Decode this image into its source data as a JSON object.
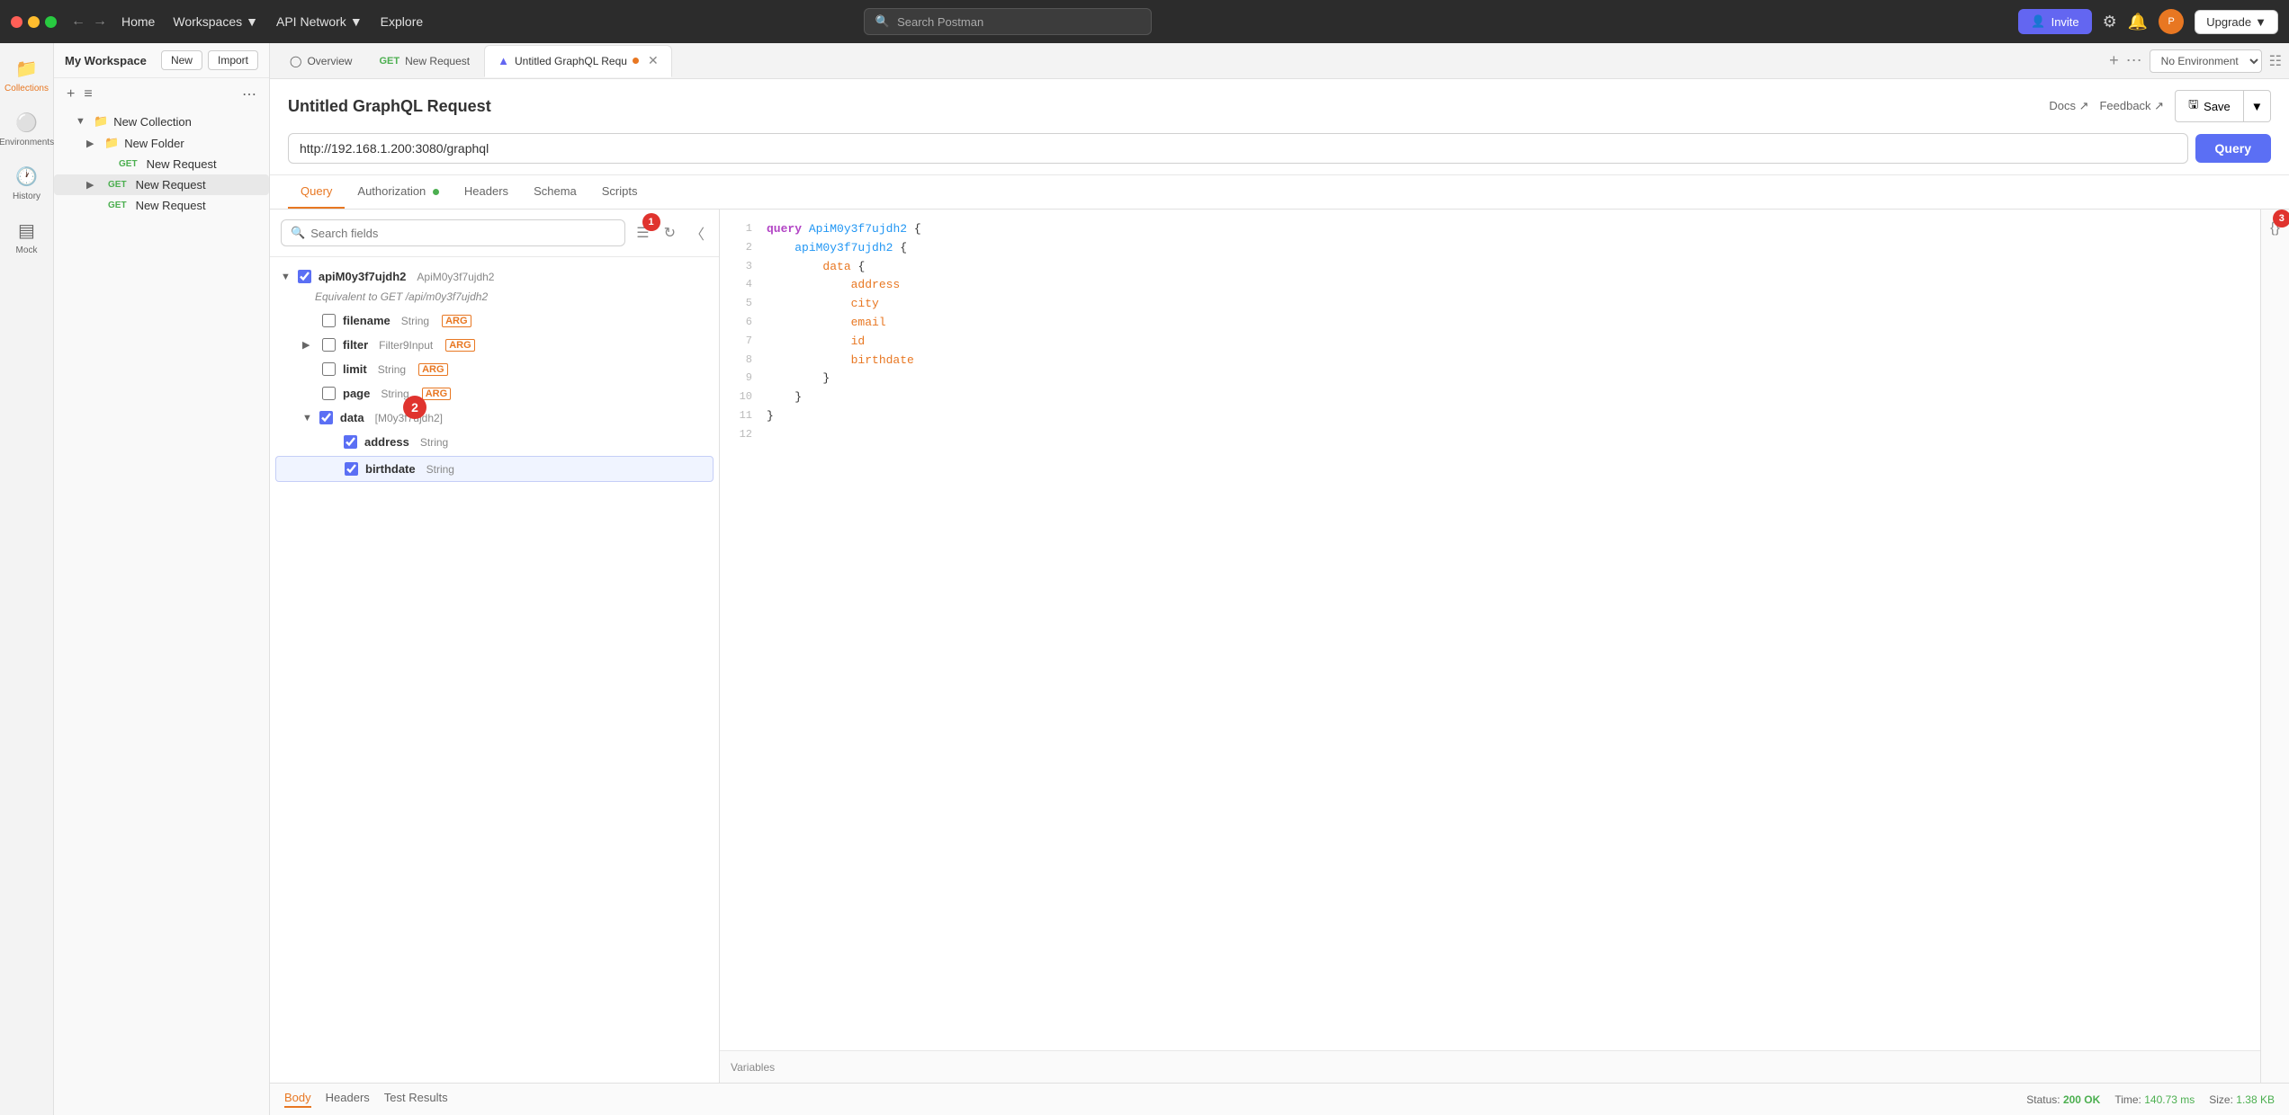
{
  "topbar": {
    "nav_items": [
      "Home",
      "Workspaces",
      "API Network",
      "Explore"
    ],
    "search_placeholder": "Search Postman",
    "invite_label": "Invite",
    "upgrade_label": "Upgrade"
  },
  "sidebar": {
    "workspace_name": "My Workspace",
    "new_label": "New",
    "import_label": "Import",
    "collections_label": "Collections",
    "environments_label": "Environments",
    "history_label": "History",
    "mock_label": "Mock",
    "collection_name": "New Collection",
    "folder_name": "New Folder",
    "requests": [
      {
        "method": "GET",
        "name": "New Request",
        "indent": 2
      },
      {
        "method": "GET",
        "name": "New Request",
        "indent": 3
      },
      {
        "method": "GET",
        "name": "New Request",
        "indent": 2
      }
    ]
  },
  "tabs": [
    {
      "label": "Overview",
      "type": "overview",
      "active": false
    },
    {
      "label": "New Request",
      "type": "get",
      "active": false
    },
    {
      "label": "Untitled GraphQL Requ",
      "type": "graphql",
      "active": true,
      "dot": true
    }
  ],
  "env_select": "No Environment",
  "request": {
    "title": "Untitled GraphQL Request",
    "docs_label": "Docs ↗",
    "feedback_label": "Feedback ↗",
    "save_label": "Save",
    "url": "http://192.168.1.200:3080/graphql",
    "query_button": "Query"
  },
  "query_tabs": [
    {
      "label": "Query",
      "active": true
    },
    {
      "label": "Authorization",
      "dot": true,
      "active": false
    },
    {
      "label": "Headers",
      "active": false
    },
    {
      "label": "Schema",
      "active": false
    },
    {
      "label": "Scripts",
      "active": false
    }
  ],
  "fields_panel": {
    "search_placeholder": "Search fields",
    "group": {
      "name": "apiM0y3f7ujdh2",
      "type": "ApiM0y3f7ujdh2",
      "desc": "Equivalent to GET /api/m0y3f7ujdh2",
      "checked": true,
      "fields": [
        {
          "name": "filename",
          "type": "String",
          "arg": "ARG",
          "checked": false,
          "expandable": false
        },
        {
          "name": "filter",
          "type": "Filter9Input",
          "arg": "ARG",
          "checked": false,
          "expandable": true
        },
        {
          "name": "limit",
          "type": "String",
          "arg": "ARG",
          "checked": false,
          "expandable": false
        },
        {
          "name": "page",
          "type": "String",
          "arg": "ARG",
          "checked": false,
          "expandable": false
        },
        {
          "name": "data",
          "type": "[M0y3f7ujdh2]",
          "checked": true,
          "expandable": true,
          "subfields": [
            {
              "name": "address",
              "type": "String",
              "checked": true
            },
            {
              "name": "birthdate",
              "type": "String",
              "checked": true,
              "highlighted": true
            }
          ]
        }
      ]
    }
  },
  "code_editor": {
    "lines": [
      {
        "num": 1,
        "code": "query ApiM0y3f7ujdh2 {",
        "parts": [
          {
            "t": "kw",
            "v": "query"
          },
          {
            "t": "text",
            "v": " "
          },
          {
            "t": "fn",
            "v": "ApiM0y3f7ujdh2"
          },
          {
            "t": "text",
            "v": " {"
          }
        ]
      },
      {
        "num": 2,
        "code": "    apiM0y3f7ujdh2 {",
        "parts": [
          {
            "t": "text",
            "v": "    "
          },
          {
            "t": "fn",
            "v": "apiM0y3f7ujdh2"
          },
          {
            "t": "text",
            "v": " {"
          }
        ]
      },
      {
        "num": 3,
        "code": "        data {",
        "parts": [
          {
            "t": "text",
            "v": "        "
          },
          {
            "t": "field",
            "v": "data"
          },
          {
            "t": "text",
            "v": " {"
          }
        ]
      },
      {
        "num": 4,
        "code": "            address",
        "parts": [
          {
            "t": "text",
            "v": "            "
          },
          {
            "t": "field",
            "v": "address"
          }
        ]
      },
      {
        "num": 5,
        "code": "            city",
        "parts": [
          {
            "t": "text",
            "v": "            "
          },
          {
            "t": "field",
            "v": "city"
          }
        ]
      },
      {
        "num": 6,
        "code": "            email",
        "parts": [
          {
            "t": "text",
            "v": "            "
          },
          {
            "t": "field",
            "v": "email"
          }
        ]
      },
      {
        "num": 7,
        "code": "            id",
        "parts": [
          {
            "t": "text",
            "v": "            "
          },
          {
            "t": "field",
            "v": "id"
          }
        ]
      },
      {
        "num": 8,
        "code": "            birthdate",
        "parts": [
          {
            "t": "text",
            "v": "            "
          },
          {
            "t": "field",
            "v": "birthdate"
          }
        ]
      },
      {
        "num": 9,
        "code": "        }",
        "parts": [
          {
            "t": "text",
            "v": "        }"
          }
        ]
      },
      {
        "num": 10,
        "code": "    }",
        "parts": [
          {
            "t": "text",
            "v": "    }"
          }
        ]
      },
      {
        "num": 11,
        "code": "}",
        "parts": [
          {
            "t": "text",
            "v": "}"
          }
        ]
      },
      {
        "num": 12,
        "code": "",
        "parts": []
      }
    ]
  },
  "variables_label": "Variables",
  "bottom_tabs": [
    {
      "label": "Body",
      "active": true
    },
    {
      "label": "Headers",
      "active": false
    },
    {
      "label": "Test Results",
      "active": false
    }
  ],
  "status": {
    "status_label": "Status:",
    "status_value": "200 OK",
    "time_label": "Time:",
    "time_value": "140.73 ms",
    "size_label": "Size:",
    "size_value": "1.38 KB"
  },
  "badges": {
    "badge1": "1",
    "badge2": "2",
    "badge3": "3"
  }
}
